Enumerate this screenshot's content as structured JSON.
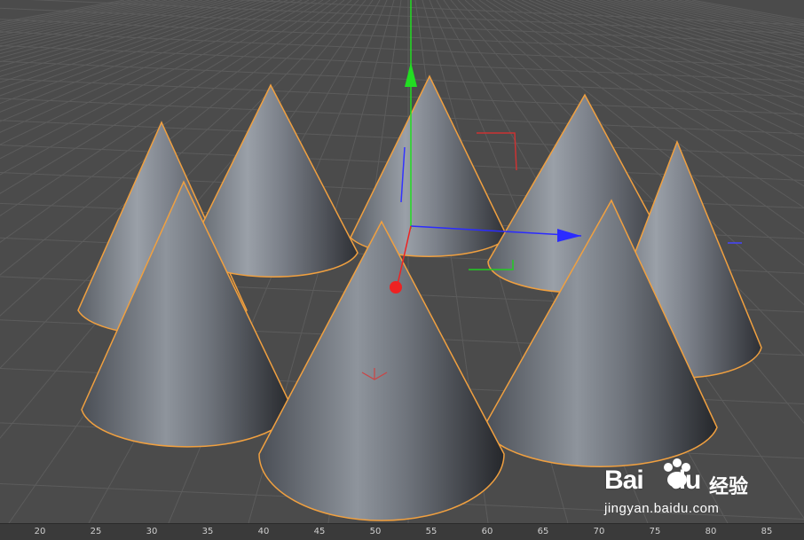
{
  "viewport": {
    "background_color": "#4a4a4a",
    "grid_color": "#5a5a5a",
    "selection_outline_color": "#f0a040",
    "axis_colors": {
      "x": "#2b2bff",
      "y": "#22dd22",
      "z": "#ee2222"
    }
  },
  "timeline": {
    "ticks": [
      "20",
      "25",
      "30",
      "35",
      "40",
      "45",
      "50",
      "55",
      "60",
      "65",
      "70",
      "75",
      "80",
      "85"
    ]
  },
  "watermark": {
    "logo_text": "Bai",
    "logo_suffix": "du",
    "chinese": "经验",
    "url": "jingyan.baidu.com"
  }
}
